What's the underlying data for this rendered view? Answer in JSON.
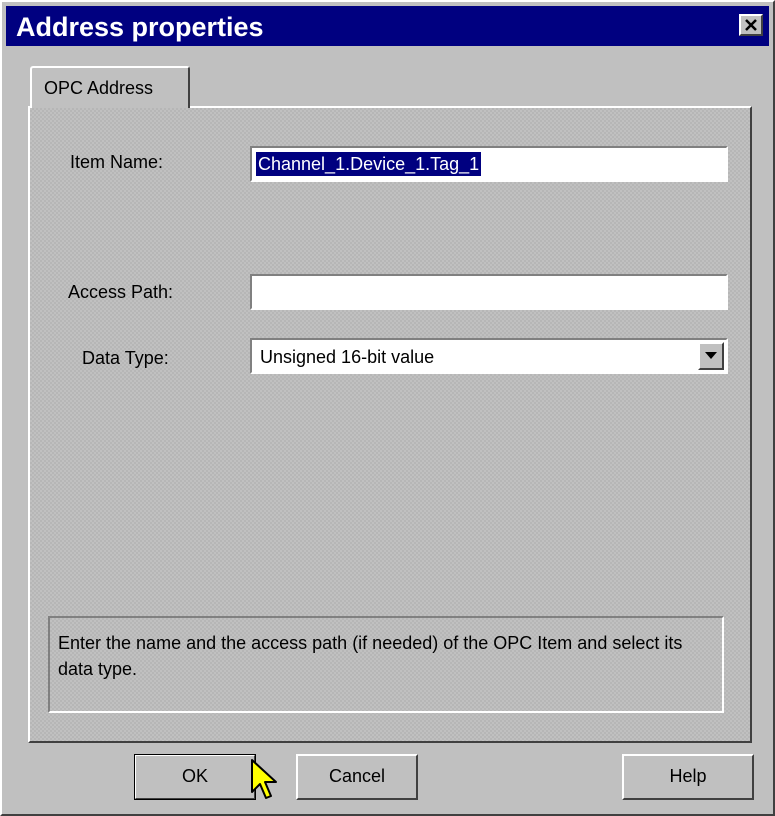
{
  "window": {
    "title": "Address properties"
  },
  "tabs": [
    {
      "label": "OPC Address"
    }
  ],
  "form": {
    "item_name_label": "Item Name:",
    "item_name_value": "Channel_1.Device_1.Tag_1",
    "access_path_label": "Access Path:",
    "access_path_value": "",
    "data_type_label": "Data Type:",
    "data_type_value": "Unsigned 16-bit value"
  },
  "help": {
    "text": "Enter the name and the access path (if needed) of the OPC Item and select its data type."
  },
  "buttons": {
    "ok": "OK",
    "cancel": "Cancel",
    "help": "Help"
  },
  "colors": {
    "titlebar": "#000080",
    "face": "#c0c0c0",
    "selection": "#000080",
    "cursor": "#ffff00"
  },
  "icons": {
    "close": "close-icon",
    "dropdown": "chevron-down-icon",
    "pointer": "mouse-pointer-icon"
  }
}
